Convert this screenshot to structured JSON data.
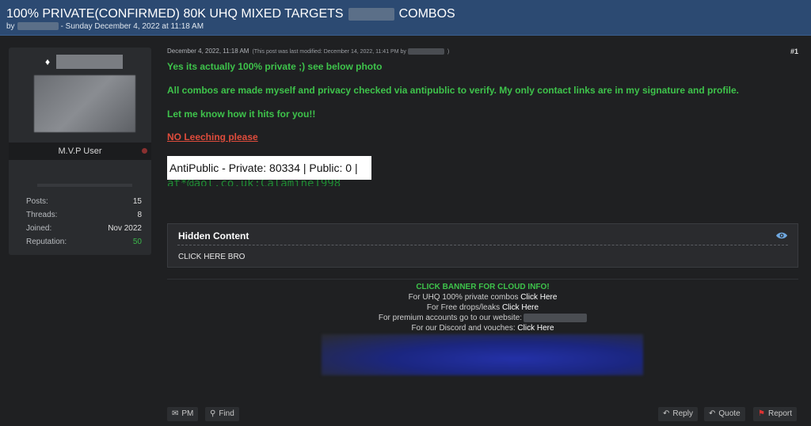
{
  "thread": {
    "title_prefix": "100% PRIVATE(CONFIRMED) 80K UHQ MIXED TARGETS",
    "title_suffix": "COMBOS",
    "by": "by",
    "date": "- Sunday December 4, 2022 at 11:18 AM"
  },
  "author": {
    "user_title": "M.V.P User",
    "stats": [
      {
        "label": "Posts:",
        "value": "15"
      },
      {
        "label": "Threads:",
        "value": "8"
      },
      {
        "label": "Joined:",
        "value": "Nov 2022"
      },
      {
        "label": "Reputation:",
        "value": "50"
      }
    ]
  },
  "post": {
    "timestamp": "December 4, 2022, 11:18 AM",
    "modified_note": "(This post was last modified: December 14, 2022, 11:41 PM by",
    "modified_close": ")",
    "number": "#1",
    "lines": [
      "Yes its actually 100% private ;) see below photo",
      "All combos are made myself and privacy checked via antipublic to verify. My only contact links are in my signature and profile.",
      "Let me know how it hits for you!!",
      "NO Leeching please"
    ],
    "quote_text": "AntiPublic - Private: 80334 | Public: 0 |",
    "quote_under": "at*@aol.co.uk:Calamine1998",
    "hidden": {
      "title": "Hidden Content",
      "link": "CLICK HERE BRO"
    }
  },
  "signature": {
    "heading": "CLICK BANNER FOR CLOUD INFO!",
    "line1_text": "For UHQ 100% private combos",
    "line2_text": "For Free drops/leaks",
    "line3_text": "For premium accounts go to our website:",
    "line4_text": "For our Discord and vouches:",
    "link": "Click Here"
  },
  "actions": {
    "pm": "PM",
    "find": "Find",
    "reply": "Reply",
    "quote": "Quote",
    "report": "Report"
  },
  "colors": {
    "header_bg": "#2c4a72",
    "page_bg": "#1f2022",
    "accent_green": "#3ec34b",
    "warning_red": "#e04c3c"
  },
  "icons": [
    "diamond-icon",
    "eye-icon",
    "envelope-icon",
    "search-icon",
    "reply-icon",
    "quote-icon",
    "flag-icon"
  ]
}
